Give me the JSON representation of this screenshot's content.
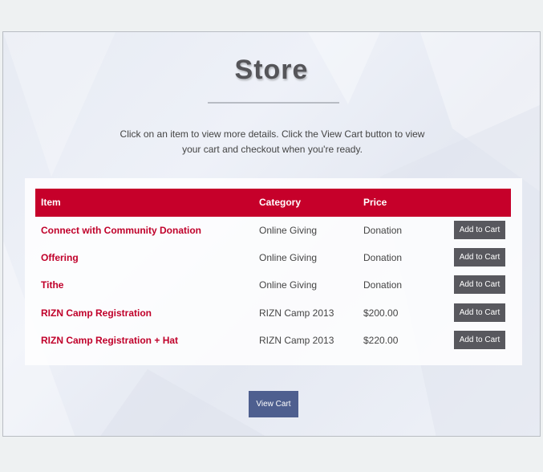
{
  "page": {
    "title": "Store",
    "intro": "Click on an item to view more details. Click the View Cart button to view your cart and checkout when you're ready."
  },
  "table": {
    "headers": {
      "item": "Item",
      "category": "Category",
      "price": "Price"
    },
    "rows": [
      {
        "item": "Connect with Community Donation",
        "category": "Online Giving",
        "price": "Donation",
        "button": "Add to Cart"
      },
      {
        "item": "Offering",
        "category": "Online Giving",
        "price": "Donation",
        "button": "Add to Cart"
      },
      {
        "item": "Tithe",
        "category": "Online Giving",
        "price": "Donation",
        "button": "Add to Cart"
      },
      {
        "item": "RIZN Camp Registration",
        "category": "RIZN Camp 2013",
        "price": "$200.00",
        "button": "Add to Cart"
      },
      {
        "item": "RIZN Camp Registration + Hat",
        "category": "RIZN Camp 2013",
        "price": "$220.00",
        "button": "Add to Cart"
      }
    ]
  },
  "view_cart_label": "View Cart",
  "colors": {
    "accent_red": "#c6002a",
    "button_gray": "#58585e",
    "view_cart_blue": "#4e5f8f"
  }
}
